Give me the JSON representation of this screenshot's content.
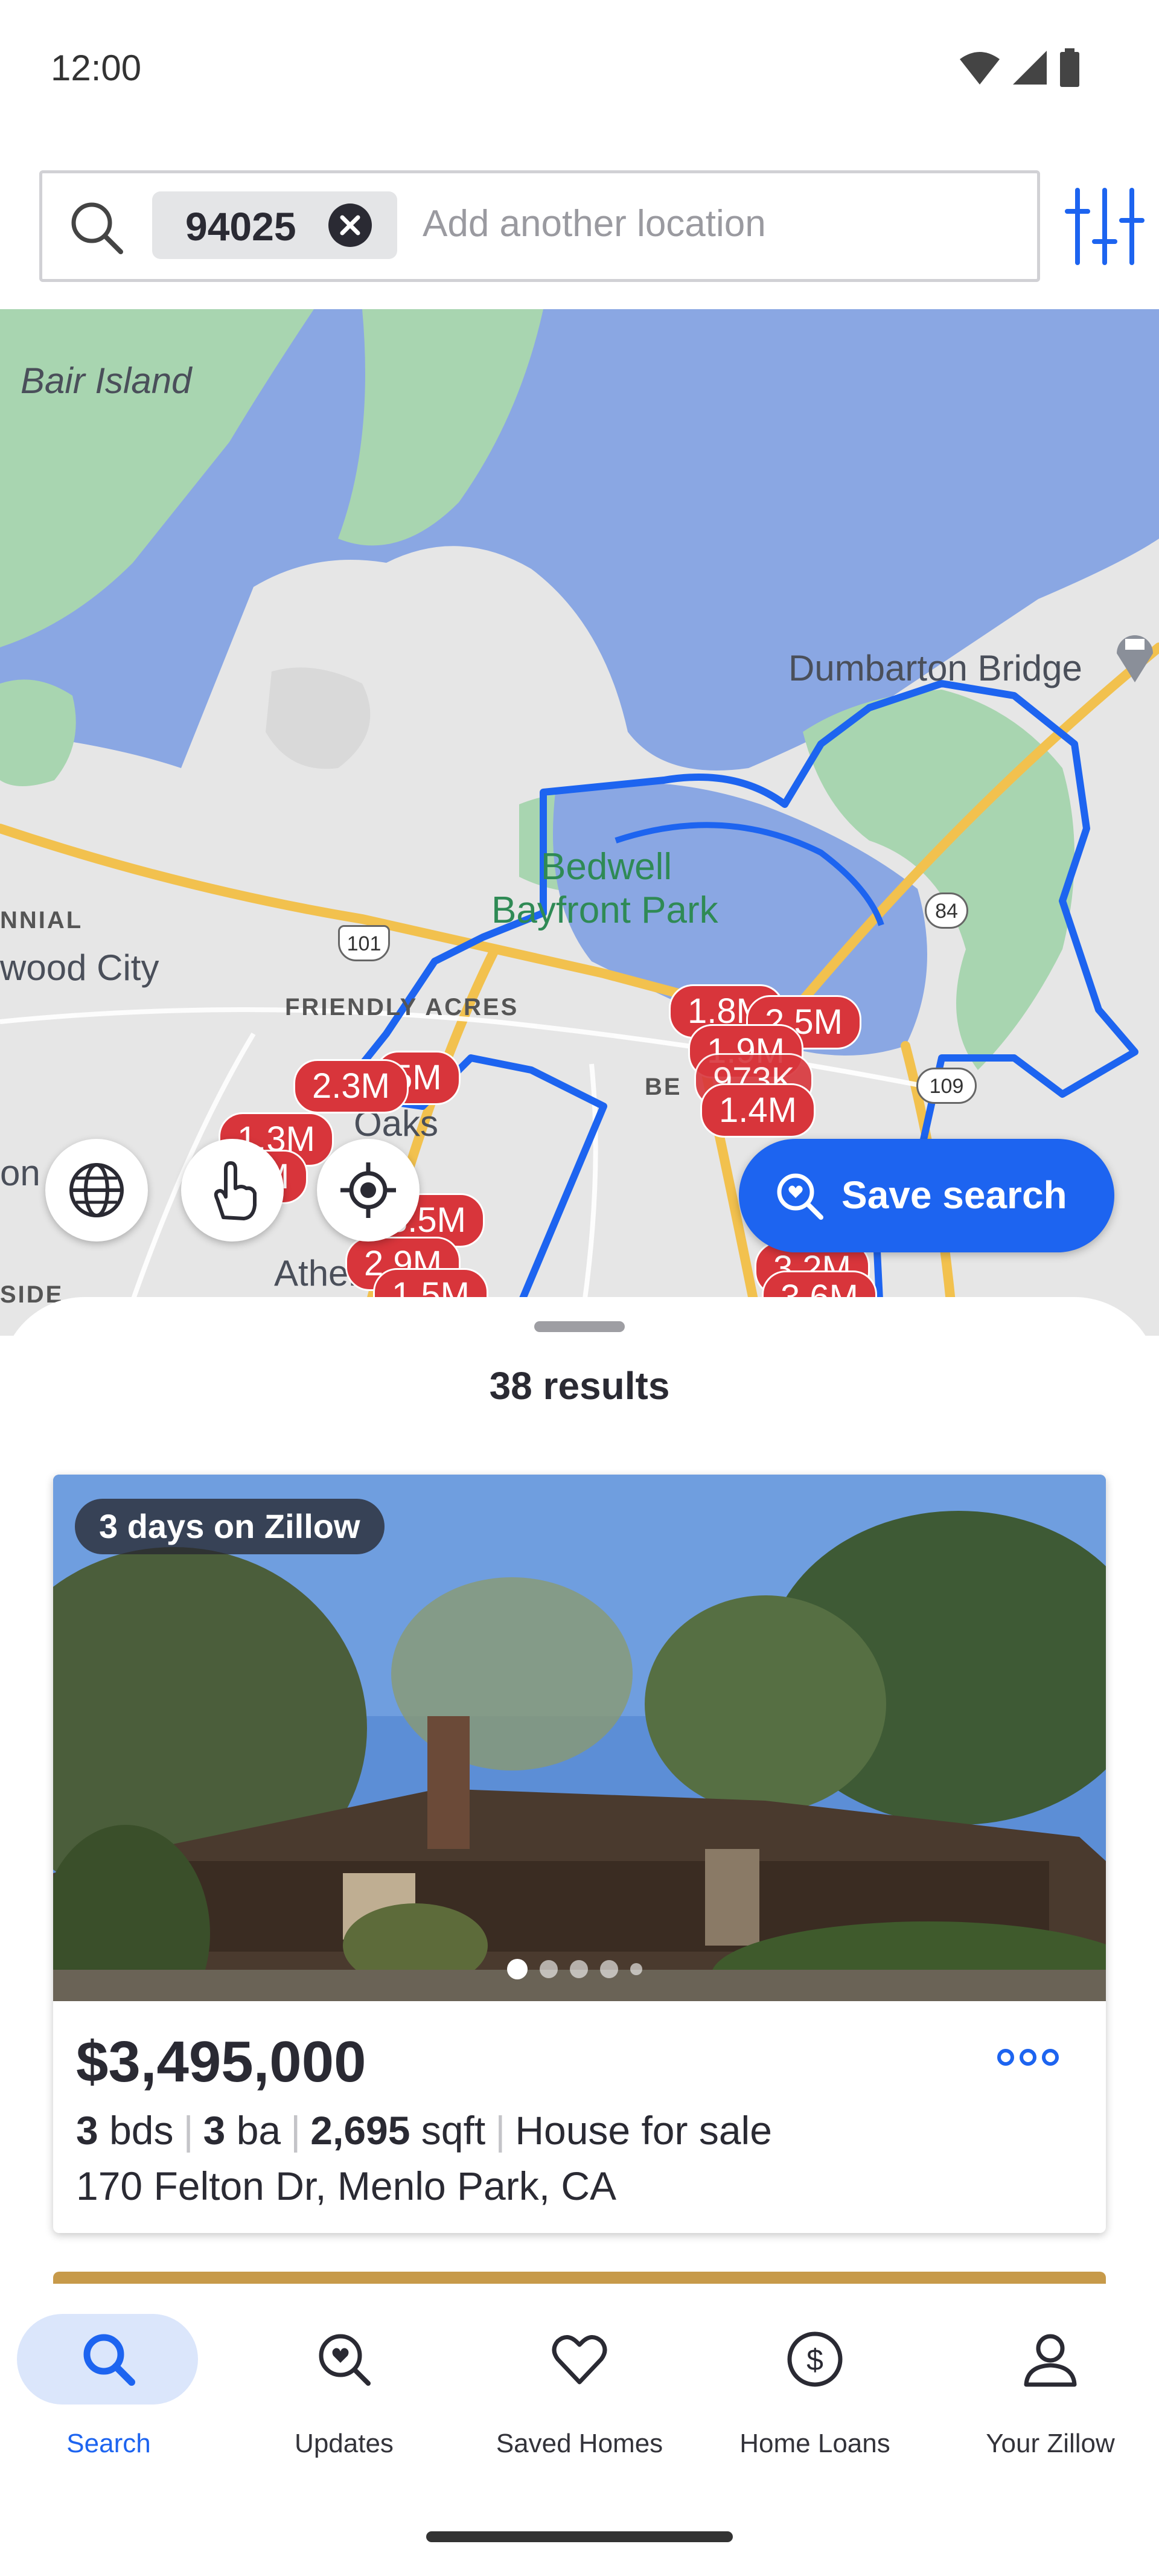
{
  "status_bar": {
    "time": "12:00"
  },
  "search": {
    "chip_text": "94025",
    "placeholder": "Add another location"
  },
  "map": {
    "labels": {
      "bair_island": "Bair Island",
      "dumbarton_bridge": "Dumbarton Bridge",
      "bedwell_1": "Bedwell",
      "bedwell_2": "Bayfront Park",
      "redwood_city": "wood City",
      "ennial": "NNIAL",
      "friendly_acres": "FRIENDLY ACRES",
      "oaks": "Oaks",
      "ather": "Ather",
      "on": "on",
      "side": "SIDE",
      "route_101": "101",
      "route_84": "84",
      "route_109": "109",
      "bee": "BE"
    },
    "price_pins": [
      "1.8M",
      "2.5M",
      "1.9M",
      "1.4M",
      "2.3M",
      "5M",
      "1.3M",
      "M",
      "3.5M",
      "2.9M",
      "1.5M",
      "3.2M",
      "3.6M",
      "973K"
    ],
    "save_search_label": "Save search"
  },
  "results": {
    "count_label": "38 results"
  },
  "listing": {
    "days_badge": "3 days on Zillow",
    "price": "$3,495,000",
    "beds": "3",
    "beds_unit": "bds",
    "baths": "3",
    "baths_unit": "ba",
    "sqft": "2,695",
    "sqft_unit": "sqft",
    "type": "House for sale",
    "address": "170 Felton Dr, Menlo Park, CA",
    "photo_count": 5,
    "photo_index": 1
  },
  "bottom_nav": {
    "items": [
      {
        "label": "Search",
        "icon": "search-icon",
        "active": true
      },
      {
        "label": "Updates",
        "icon": "updates-icon",
        "active": false
      },
      {
        "label": "Saved Homes",
        "icon": "heart-icon",
        "active": false
      },
      {
        "label": "Home Loans",
        "icon": "dollar-icon",
        "active": false
      },
      {
        "label": "Your Zillow",
        "icon": "person-icon",
        "active": false
      }
    ]
  },
  "colors": {
    "brand_blue": "#1d64f0",
    "price_pin_red": "#d8353b",
    "water": "#8aa7e3",
    "land": "#e8e8e8",
    "park": "#a8d5b0"
  }
}
